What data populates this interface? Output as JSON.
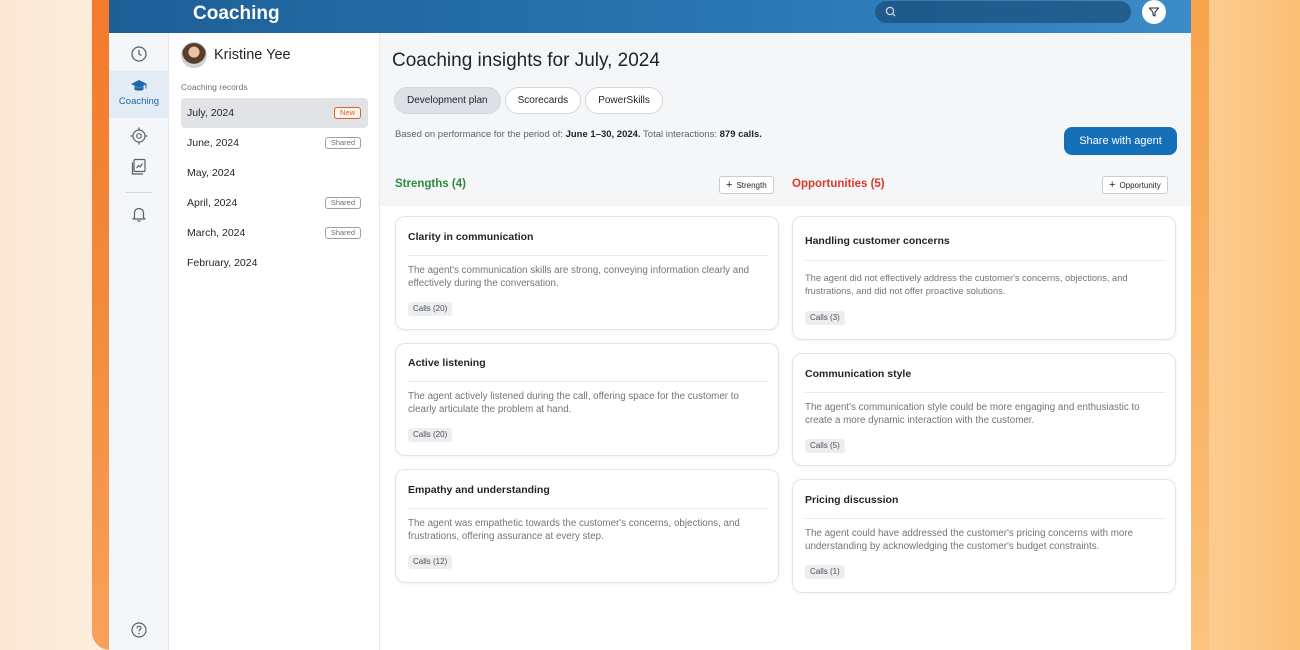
{
  "app": {
    "title": "Coaching"
  },
  "search": {
    "placeholder": ""
  },
  "rail": {
    "coaching_label": "Coaching"
  },
  "user": {
    "name": "Kristine Yee"
  },
  "records": {
    "heading": "Coaching records",
    "items": [
      {
        "label": "July, 2024",
        "badge": "New"
      },
      {
        "label": "June, 2024",
        "badge": "Shared"
      },
      {
        "label": "May, 2024",
        "badge": ""
      },
      {
        "label": "April, 2024",
        "badge": "Shared"
      },
      {
        "label": "March, 2024",
        "badge": "Shared"
      },
      {
        "label": "February, 2024",
        "badge": ""
      }
    ]
  },
  "main": {
    "title": "Coaching insights for July, 2024",
    "tabs": [
      "Development plan",
      "Scorecards",
      "PowerSkills"
    ],
    "period_prefix": "Based on performance for the period of:",
    "period_range": "June 1–30, 2024.",
    "interactions_prefix": "Total interactions:",
    "interactions_value": "879 calls.",
    "share_label": "Share with agent"
  },
  "strengths": {
    "heading": "Strengths (4)",
    "add_label": "Strength",
    "cards": [
      {
        "title": "Clarity in communication",
        "description": "The agent's communication skills are strong, conveying information clearly and effectively during the conversation.",
        "calls": "Calls (20)"
      },
      {
        "title": "Active listening",
        "description": "The agent actively listened during the call, offering space for the customer to clearly articulate the problem at hand.",
        "calls": "Calls (20)"
      },
      {
        "title": "Empathy and understanding",
        "description": "The agent was empathetic towards the customer's concerns, objections, and frustrations, offering assurance at every step.",
        "calls": "Calls (12)"
      }
    ]
  },
  "opportunities": {
    "heading": "Opportunities (5)",
    "add_label": "Opportunity",
    "cards": [
      {
        "title": "Handling customer concerns",
        "description": "The agent did not effectively address the customer's concerns, objections, and frustrations, and did not offer proactive solutions.",
        "calls": "Calls (3)"
      },
      {
        "title": "Communication style",
        "description": "The agent's communication style could be more engaging and enthusiastic to create a more dynamic interaction with the customer.",
        "calls": "Calls (5)"
      },
      {
        "title": "Pricing discussion",
        "description": "The agent could have addressed the customer's pricing concerns with more understanding by acknowledging the customer's budget constraints.",
        "calls": "Calls (1)"
      }
    ]
  },
  "colors": {
    "topbar": "#2a77b4",
    "accent": "#1570b8",
    "strength": "#2e8a3c",
    "opportunity": "#d93a2b",
    "new_badge": "#d5622b"
  },
  "icons": [
    "history-icon",
    "coaching-cap-icon",
    "target-icon",
    "reports-icon",
    "bell-icon",
    "help-icon",
    "search-icon",
    "filter-icon",
    "plus-icon"
  ]
}
